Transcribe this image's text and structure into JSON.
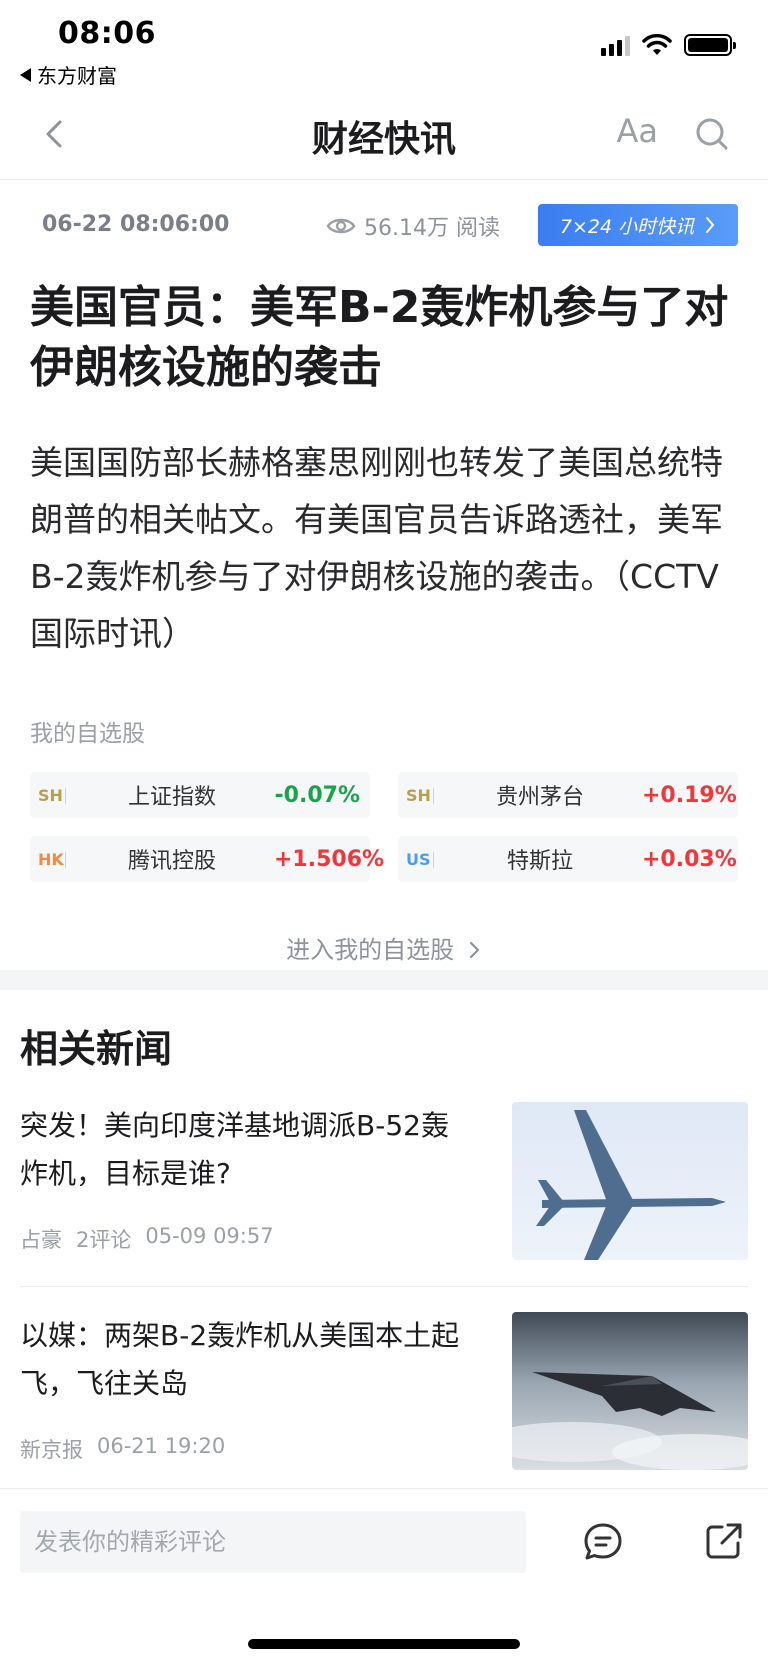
{
  "status_bar": {
    "time": "08:06",
    "back_app": "东方财富"
  },
  "nav": {
    "title": "财经快讯",
    "font_size_label": "Aa",
    "icons": [
      "back-chevron-icon",
      "font-size-icon",
      "search-icon"
    ]
  },
  "article": {
    "timestamp": "06-22 08:06:00",
    "views": "56.14万 阅读",
    "badge_label": "7×24 小时快讯",
    "headline": "美国官员：美军B-2轰炸机参与了对伊朗核设施的袭击",
    "body": "美国国防部长赫格塞思刚刚也转发了美国总统特朗普的相关帖文。有美国官员告诉路透社，美军B-2轰炸机参与了对伊朗核设施的袭击。（CCTV国际时讯）"
  },
  "watchlist": {
    "title": "我的自选股",
    "enter_label": "进入我的自选股",
    "stocks": [
      {
        "market": "SH",
        "market_color": "#b8a14a",
        "name": "上证指数",
        "change": "-0.07%",
        "change_color": "#1aa34a"
      },
      {
        "market": "SH",
        "market_color": "#b8a14a",
        "name": "贵州茅台",
        "change": "+0.19%",
        "change_color": "#f0383b"
      },
      {
        "market": "HK",
        "market_color": "#f08a3c",
        "name": "腾讯控股",
        "change": "+1.506%",
        "change_color": "#f0383b"
      },
      {
        "market": "US",
        "market_color": "#4a9ef0",
        "name": "特斯拉",
        "change": "+0.03%",
        "change_color": "#f0383b"
      }
    ]
  },
  "related": {
    "title": "相关新闻",
    "items": [
      {
        "title": "突发！美向印度洋基地调派B-52轰炸机，目标是谁?",
        "source": "占豪",
        "comments": "2评论",
        "time": "05-09 09:57"
      },
      {
        "title": "以媒：两架B-2轰炸机从美国本土起飞，飞往关岛",
        "source": "新京报",
        "comments": "",
        "time": "06-21 19:20"
      }
    ]
  },
  "bottom_bar": {
    "comment_placeholder": "发表你的精彩评论"
  },
  "colors": {
    "accent_blue": "#3b7df0",
    "up_red": "#f0383b",
    "down_green": "#1aa34a"
  }
}
